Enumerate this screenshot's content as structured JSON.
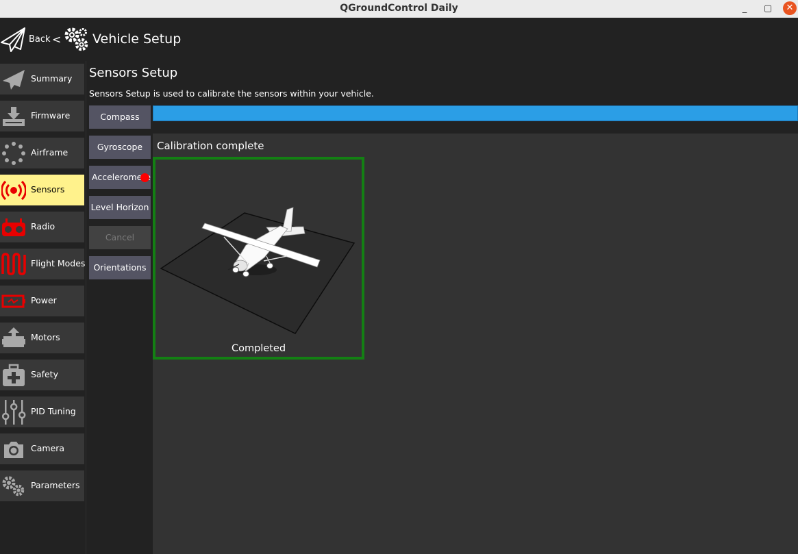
{
  "window": {
    "title": "QGroundControl Daily",
    "minimize": "_",
    "maximize": "▢",
    "close": "✕"
  },
  "toolbar": {
    "back_label": "Back",
    "separator": "<",
    "page_title": "Vehicle Setup"
  },
  "sidebar": {
    "items": [
      {
        "label": "Summary",
        "icon": "paper-plane-icon",
        "active": false
      },
      {
        "label": "Firmware",
        "icon": "download-icon",
        "active": false
      },
      {
        "label": "Airframe",
        "icon": "airframe-dots-icon",
        "active": false
      },
      {
        "label": "Sensors",
        "icon": "sensors-signal-icon",
        "active": true
      },
      {
        "label": "Radio",
        "icon": "radio-icon",
        "active": false
      },
      {
        "label": "Flight Modes",
        "icon": "flight-modes-wave-icon",
        "active": false
      },
      {
        "label": "Power",
        "icon": "battery-icon",
        "active": false
      },
      {
        "label": "Motors",
        "icon": "motor-icon",
        "active": false
      },
      {
        "label": "Safety",
        "icon": "first-aid-icon",
        "active": false
      },
      {
        "label": "PID Tuning",
        "icon": "sliders-icon",
        "active": false
      },
      {
        "label": "Camera",
        "icon": "camera-icon",
        "active": false
      },
      {
        "label": "Parameters",
        "icon": "gears-icon",
        "active": false
      }
    ]
  },
  "sensors": {
    "title": "Sensors Setup",
    "description": "Sensors Setup is used to calibrate the sensors within your vehicle.",
    "buttons": {
      "compass": "Compass",
      "gyroscope": "Gyroscope",
      "accelerometer": "Accelerometer",
      "level_horizon": "Level Horizon",
      "cancel": "Cancel",
      "orientations": "Orientations"
    },
    "progress": 1.0,
    "status": "Calibration complete",
    "orientation_caption": "Completed"
  },
  "colors": {
    "active_nav": "#fff28c",
    "progress": "#2b9ee6",
    "complete_border": "#138013",
    "alert_dot": "#ff0000",
    "button": "#545463"
  }
}
